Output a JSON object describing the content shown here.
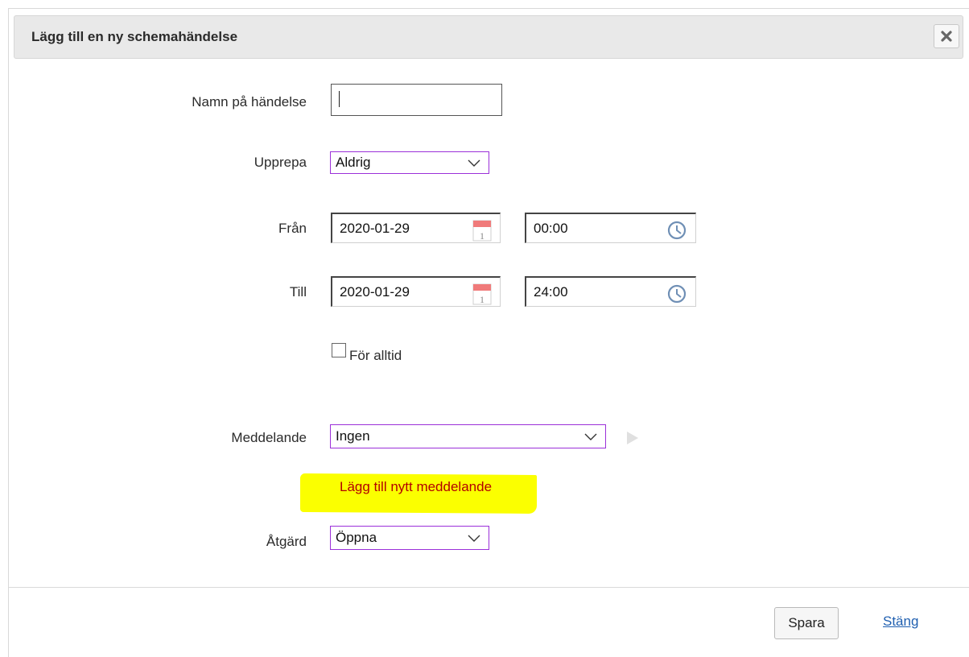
{
  "dialog": {
    "title": "Lägg till en ny schemahändelse",
    "close_icon": "close-x-icon"
  },
  "form": {
    "name": {
      "label": "Namn på händelse",
      "value": ""
    },
    "repeat": {
      "label": "Upprepa",
      "selected": "Aldrig"
    },
    "from": {
      "label": "Från",
      "date": "2020-01-29",
      "time": "00:00"
    },
    "to": {
      "label": "Till",
      "date": "2020-01-29",
      "time": "24:00"
    },
    "forever": {
      "label": "För alltid",
      "checked": false
    },
    "message": {
      "label": "Meddelande",
      "selected": "Ingen",
      "add_link": "Lägg till nytt meddelande"
    },
    "action": {
      "label": "Åtgärd",
      "selected": "Öppna"
    }
  },
  "footer": {
    "save_label": "Spara",
    "close_label": "Stäng"
  },
  "colors": {
    "select_border": "#9b30d9",
    "highlight": "#fbff00",
    "add_link": "#b30000",
    "link": "#1f5fb0"
  }
}
